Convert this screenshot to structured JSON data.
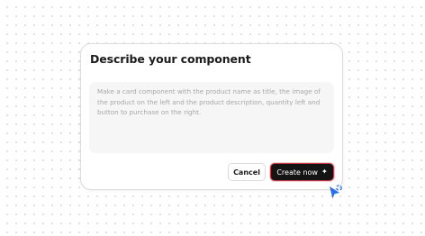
{
  "dialog": {
    "title": "Describe your component",
    "prompt_text": "Make a card component with the product name as title, the image of the product on the left and the product description, quantity left and button to purchase on the right."
  },
  "actions": {
    "cancel_label": "Cancel",
    "create_label": "Create now",
    "create_icon": "sparkle-icon"
  },
  "colors": {
    "accent_border": "#c4384a",
    "primary_button": "#141414",
    "cursor": "#2b6fe8"
  }
}
